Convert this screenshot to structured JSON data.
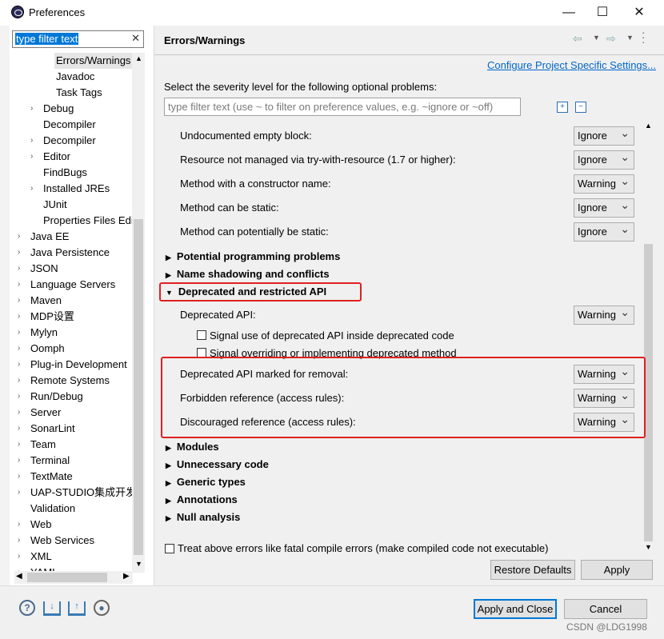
{
  "window": {
    "title": "Preferences",
    "min": "—",
    "max": "☐",
    "close": "✕"
  },
  "filter": {
    "value": "type filter text",
    "clear": "✕"
  },
  "tree": [
    {
      "label": "Errors/Warnings",
      "indent": 68,
      "arrow": "",
      "selected": true
    },
    {
      "label": "Javadoc",
      "indent": 68,
      "arrow": ""
    },
    {
      "label": "Task Tags",
      "indent": 68,
      "arrow": ""
    },
    {
      "label": "Debug",
      "indent": 52,
      "arrow": "›"
    },
    {
      "label": "Decompiler",
      "indent": 52,
      "arrow": ""
    },
    {
      "label": "Decompiler",
      "indent": 52,
      "arrow": "›"
    },
    {
      "label": "Editor",
      "indent": 52,
      "arrow": "›"
    },
    {
      "label": "FindBugs",
      "indent": 52,
      "arrow": ""
    },
    {
      "label": "Installed JREs",
      "indent": 52,
      "arrow": "›"
    },
    {
      "label": "JUnit",
      "indent": 52,
      "arrow": ""
    },
    {
      "label": "Properties Files Edi",
      "indent": 52,
      "arrow": ""
    },
    {
      "label": "Java EE",
      "indent": 36,
      "arrow": "›"
    },
    {
      "label": "Java Persistence",
      "indent": 36,
      "arrow": "›"
    },
    {
      "label": "JSON",
      "indent": 36,
      "arrow": "›"
    },
    {
      "label": "Language Servers",
      "indent": 36,
      "arrow": "›"
    },
    {
      "label": "Maven",
      "indent": 36,
      "arrow": "›"
    },
    {
      "label": "MDP设置",
      "indent": 36,
      "arrow": "›"
    },
    {
      "label": "Mylyn",
      "indent": 36,
      "arrow": "›"
    },
    {
      "label": "Oomph",
      "indent": 36,
      "arrow": "›"
    },
    {
      "label": "Plug-in Development",
      "indent": 36,
      "arrow": "›"
    },
    {
      "label": "Remote Systems",
      "indent": 36,
      "arrow": "›"
    },
    {
      "label": "Run/Debug",
      "indent": 36,
      "arrow": "›"
    },
    {
      "label": "Server",
      "indent": 36,
      "arrow": "›"
    },
    {
      "label": "SonarLint",
      "indent": 36,
      "arrow": "›"
    },
    {
      "label": "Team",
      "indent": 36,
      "arrow": "›"
    },
    {
      "label": "Terminal",
      "indent": 36,
      "arrow": "›"
    },
    {
      "label": "TextMate",
      "indent": 36,
      "arrow": "›"
    },
    {
      "label": "UAP-STUDIO集成开发环",
      "indent": 36,
      "arrow": "›"
    },
    {
      "label": "Validation",
      "indent": 36,
      "arrow": ""
    },
    {
      "label": "Web",
      "indent": 36,
      "arrow": "›"
    },
    {
      "label": "Web Services",
      "indent": 36,
      "arrow": "›"
    },
    {
      "label": "XML",
      "indent": 36,
      "arrow": "›"
    },
    {
      "label": "YAML",
      "indent": 36,
      "arrow": "›"
    }
  ],
  "page": {
    "title": "Errors/Warnings",
    "configure_link": "Configure Project Specific Settings...",
    "instruction": "Select the severity level for the following optional problems:",
    "search_placeholder": "type filter text (use ~ to filter on preference values, e.g. ~ignore or ~off)"
  },
  "options": [
    {
      "label": "Undocumented empty block:",
      "value": "Ignore"
    },
    {
      "label": "Resource not managed via try-with-resource (1.7 or higher):",
      "value": "Ignore"
    },
    {
      "label": "Method with a constructor name:",
      "value": "Warning"
    },
    {
      "label": "Method can be static:",
      "value": "Ignore"
    },
    {
      "label": "Method can potentially be static:",
      "value": "Ignore"
    }
  ],
  "sections_top": [
    "Potential programming problems",
    "Name shadowing and conflicts"
  ],
  "deprecated": {
    "header": "Deprecated and restricted API",
    "api_label": "Deprecated API:",
    "api_value": "Warning",
    "check1": "Signal use of deprecated API inside deprecated code",
    "check2": "Signal overriding or implementing deprecated method",
    "items": [
      {
        "label": "Deprecated API marked for removal:",
        "value": "Warning"
      },
      {
        "label": "Forbidden reference (access rules):",
        "value": "Warning"
      },
      {
        "label": "Discouraged reference (access rules):",
        "value": "Warning"
      }
    ]
  },
  "sections_bottom": [
    "Modules",
    "Unnecessary code",
    "Generic types",
    "Annotations",
    "Null analysis"
  ],
  "fatal_check": "Treat above errors like fatal compile errors (make compiled code not executable)",
  "buttons": {
    "restore": "Restore Defaults",
    "apply": "Apply",
    "apply_close": "Apply and Close",
    "cancel": "Cancel"
  },
  "watermark": "CSDN @LDG1998",
  "colors": {
    "accent": "#0078d7",
    "highlight": "#e02020",
    "link": "#0066cc"
  }
}
